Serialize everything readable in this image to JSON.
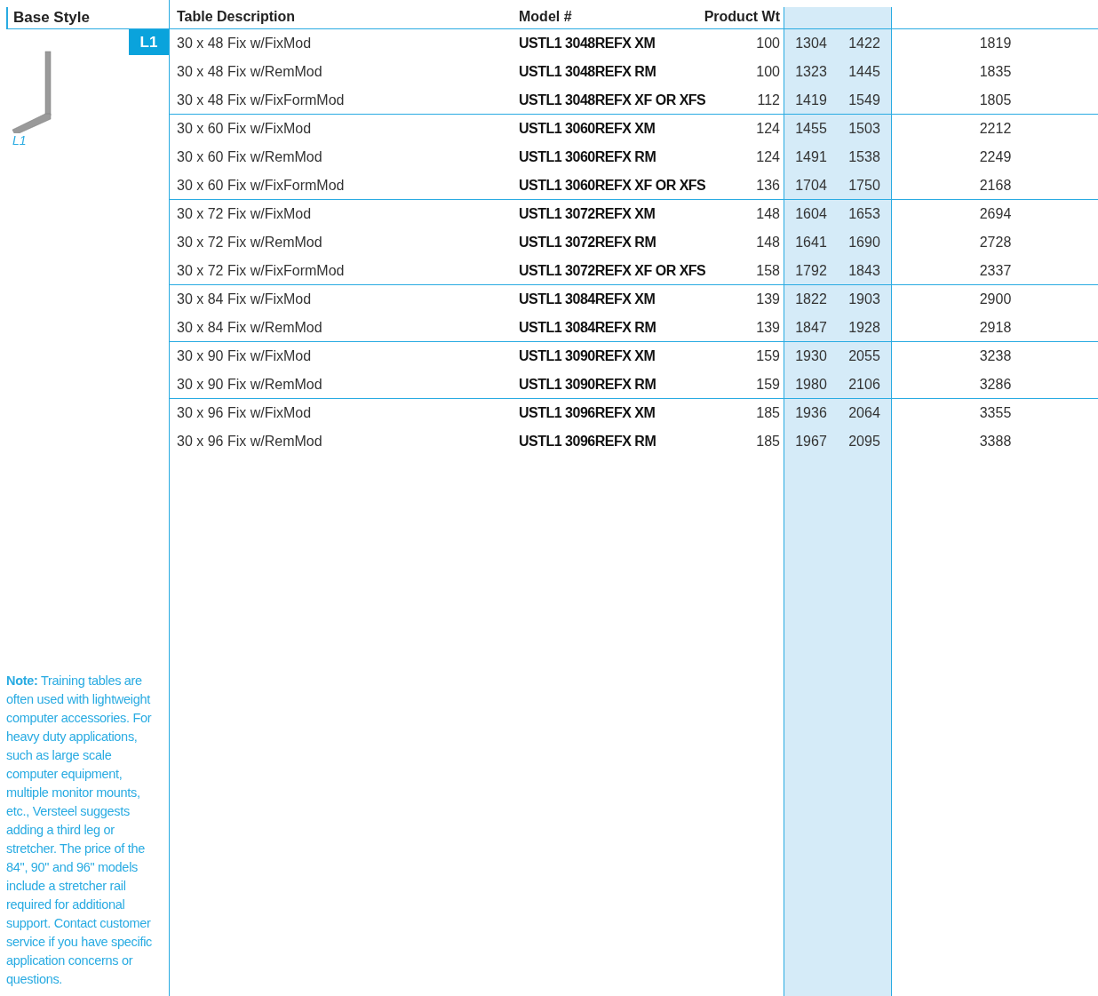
{
  "base_style": {
    "heading": "Base Style",
    "badge": "L1",
    "caption": "L1",
    "note": "**Note:** Training tables are often used with lightweight computer accessories. For heavy duty applications, such as large scale computer equipment, multiple monitor mounts, etc., Versteel suggests adding a third leg or stretcher. The price of the 84\", 90\" and 96\" models include a stretcher rail required for additional support. Contact customer service if you have specific application concerns or questions."
  },
  "table": {
    "columns": [
      "Table Description",
      "Model #",
      "Product Wt"
    ],
    "groups": [
      {
        "rows": [
          {
            "description": "30 x 48 Fix w/FixMod",
            "model": "USTL1 3048REFX XM",
            "weight": "100",
            "prices": [
              "1304",
              "1422",
              "1819"
            ]
          },
          {
            "description": "30 x 48 Fix w/RemMod",
            "model": "USTL1 3048REFX RM",
            "weight": "100",
            "prices": [
              "1323",
              "1445",
              "1835"
            ]
          },
          {
            "description": "30 x 48 Fix w/FixFormMod",
            "model": "USTL1 3048REFX XF OR XFS",
            "weight": "112",
            "prices": [
              "1419",
              "1549",
              "1805"
            ]
          }
        ]
      },
      {
        "rows": [
          {
            "description": "30 x 60 Fix w/FixMod",
            "model": "USTL1 3060REFX XM",
            "weight": "124",
            "prices": [
              "1455",
              "1503",
              "2212"
            ]
          },
          {
            "description": "30 x 60 Fix w/RemMod",
            "model": "USTL1 3060REFX RM",
            "weight": "124",
            "prices": [
              "1491",
              "1538",
              "2249"
            ]
          },
          {
            "description": "30 x 60 Fix w/FixFormMod",
            "model": "USTL1 3060REFX XF OR XFS",
            "weight": "136",
            "prices": [
              "1704",
              "1750",
              "2168"
            ]
          }
        ]
      },
      {
        "rows": [
          {
            "description": "30 x 72 Fix w/FixMod",
            "model": "USTL1 3072REFX XM",
            "weight": "148",
            "prices": [
              "1604",
              "1653",
              "2694"
            ]
          },
          {
            "description": "30 x 72 Fix w/RemMod",
            "model": "USTL1 3072REFX RM",
            "weight": "148",
            "prices": [
              "1641",
              "1690",
              "2728"
            ]
          },
          {
            "description": "30 x 72 Fix w/FixFormMod",
            "model": "USTL1 3072REFX XF OR XFS",
            "weight": "158",
            "prices": [
              "1792",
              "1843",
              "2337"
            ]
          }
        ]
      },
      {
        "rows": [
          {
            "description": "30 x 84 Fix w/FixMod",
            "model": "USTL1 3084REFX XM",
            "weight": "139",
            "prices": [
              "1822",
              "1903",
              "2900"
            ]
          },
          {
            "description": "30 x 84 Fix w/RemMod",
            "model": "USTL1 3084REFX RM",
            "weight": "139",
            "prices": [
              "1847",
              "1928",
              "2918"
            ]
          }
        ]
      },
      {
        "rows": [
          {
            "description": "30 x 90 Fix w/FixMod",
            "model": "USTL1 3090REFX XM",
            "weight": "159",
            "prices": [
              "1930",
              "2055",
              "3238"
            ]
          },
          {
            "description": "30 x 90 Fix w/RemMod",
            "model": "USTL1 3090REFX RM",
            "weight": "159",
            "prices": [
              "1980",
              "2106",
              "3286"
            ]
          }
        ]
      },
      {
        "rows": [
          {
            "description": "30 x 96 Fix w/FixMod",
            "model": "USTL1 3096REFX XM",
            "weight": "185",
            "prices": [
              "1936",
              "2064",
              "3355"
            ]
          },
          {
            "description": "30 x 96 Fix w/RemMod",
            "model": "USTL1 3096REFX RM",
            "weight": "185",
            "prices": [
              "1967",
              "2095",
              "3388"
            ]
          }
        ]
      }
    ]
  }
}
